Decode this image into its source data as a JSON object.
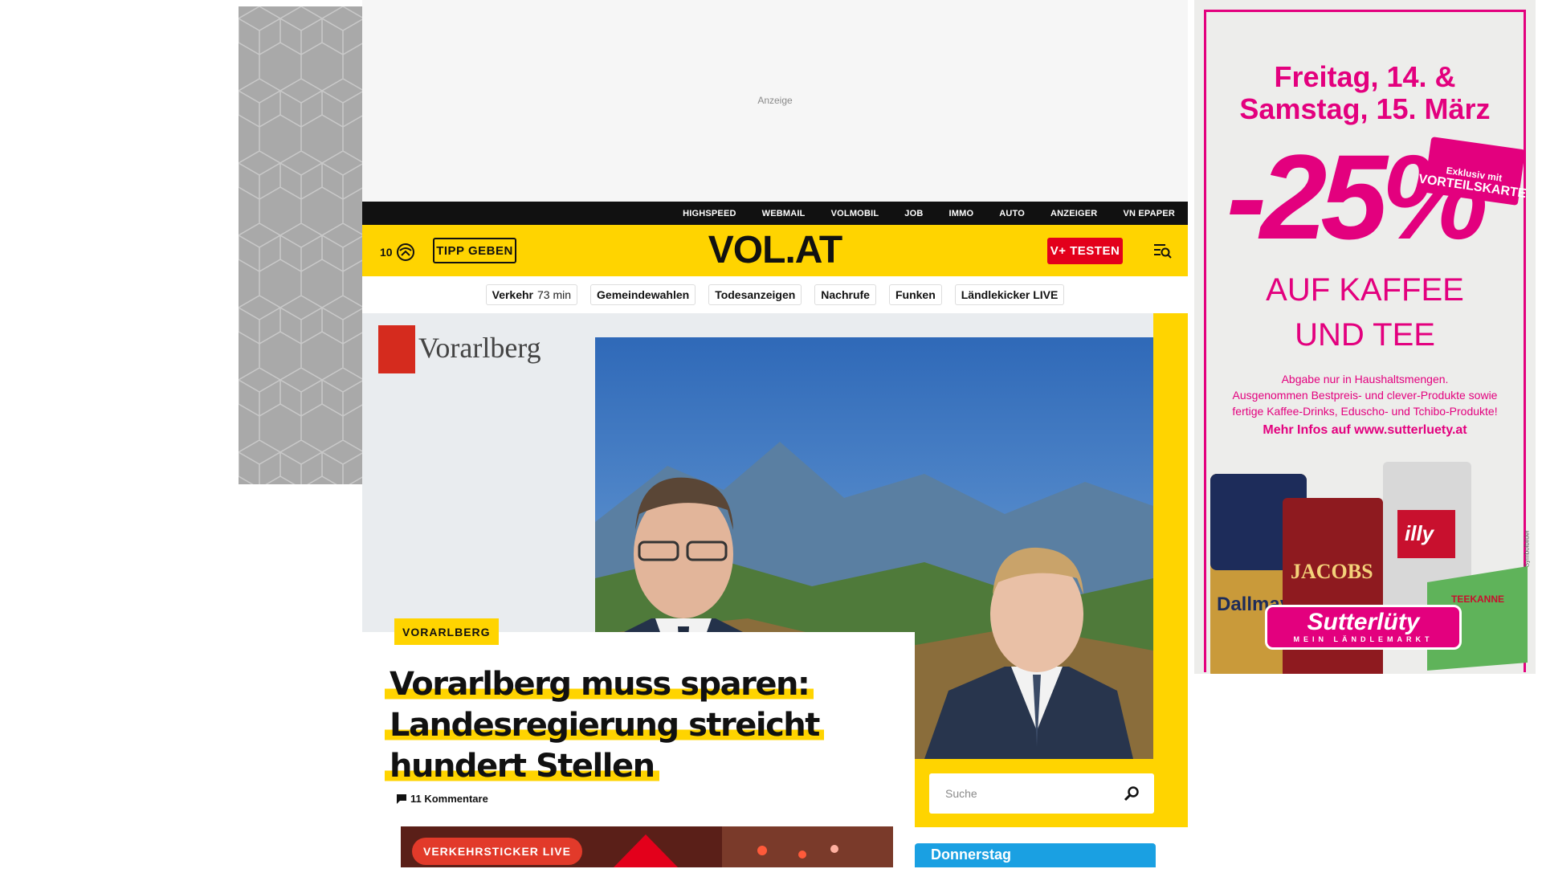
{
  "top_ad": {
    "label": "Anzeige"
  },
  "service_nav": [
    "HIGHSPEED",
    "WEBMAIL",
    "VOLMOBIL",
    "JOB",
    "IMMO",
    "AUTO",
    "ANZEIGER",
    "VN EPAPER"
  ],
  "header": {
    "temperature": "10",
    "weather_icon": "weather-icon",
    "tip_label": "TIPP GEBEN",
    "logo": "VOL.AT",
    "vplus_label": "V+ TESTEN",
    "menu_icon": "menu-search-icon"
  },
  "quick_nav": [
    {
      "label": "Verkehr",
      "extra": "73 min"
    },
    {
      "label": "Gemeindewahlen"
    },
    {
      "label": "Todesanzeigen"
    },
    {
      "label": "Nachrufe"
    },
    {
      "label": "Funken"
    },
    {
      "label": "Ländlekicker LIVE"
    }
  ],
  "hero": {
    "backdrop_text": "Vorarlberg",
    "category": "VORARLBERG",
    "headline": "Vorarlberg muss sparen: Landesregierung streicht hundert Stellen",
    "comments": "11 Kommentare"
  },
  "ticker": {
    "label": "VERKEHRSTICKER LIVE"
  },
  "search": {
    "placeholder": "Suche"
  },
  "weather_card": {
    "day": "Donnerstag"
  },
  "right_ad": {
    "date_line1": "Freitag, 14. &",
    "date_line2": "Samstag, 15. März",
    "percent": "-25%",
    "stamp_small": "Exklusiv mit",
    "stamp_big": "VORTEILSKARTE",
    "line1": "AUF KAFFEE",
    "line2": "UND TEE",
    "fine1": "Abgabe nur in Haushaltsmengen.",
    "fine2": "Ausgenommen Bestpreis- und clever-Produkte sowie",
    "fine3": "fertige Kaffee-Drinks, Eduscho- und Tchibo-Produkte!",
    "url": "Mehr Infos auf www.sutterluety.at",
    "product1": "Dallmayr",
    "product2": "JACOBS",
    "product3": "illy",
    "product4": "TEEKANNE",
    "brand": "Sutterlüty",
    "brand_tag": "MEIN LÄNDLEMARKT",
    "side_text": "Symbolbilder"
  },
  "colors": {
    "brand_yellow": "#ffd400",
    "brand_red": "#e3001b",
    "ad_pink": "#e3007e",
    "bar_black": "#111111"
  }
}
